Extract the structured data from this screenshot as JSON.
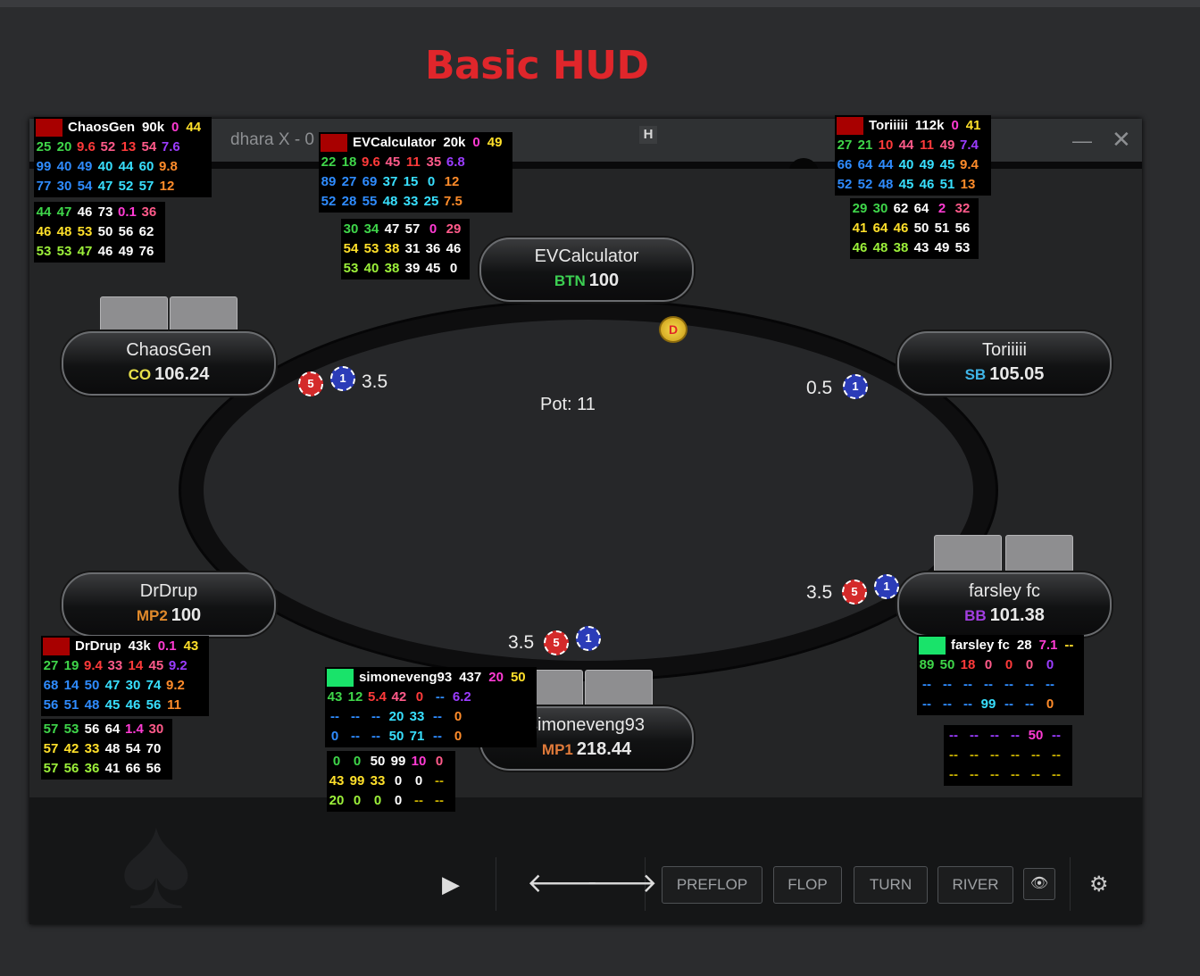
{
  "page_title": "Basic HUD",
  "window": {
    "title": "dhara X - 0",
    "minimize_glyph": "—",
    "close_glyph": "✕",
    "logo_glyph": "H"
  },
  "icons": {
    "dealer_button": "D",
    "chip_red": "5",
    "chip_blue": "1",
    "play": "▶",
    "back": "🡐",
    "forward": "🡒",
    "eye": "👁",
    "gear": "⚙",
    "spade": "♠"
  },
  "pot": "Pot:  11",
  "bets": {
    "chaosgen": "3.5",
    "toriiiii": "0.5",
    "drdrup": "3.5",
    "farsley": "3.5"
  },
  "controls": {
    "street_buttons": [
      "PREFLOP",
      "FLOP",
      "TURN",
      "RIVER"
    ]
  },
  "seats": {
    "evcalc": {
      "name": "EVCalculator",
      "pos": "BTN",
      "stack": "100",
      "pos_color": "#3ccf52"
    },
    "chaosgen": {
      "name": "ChaosGen",
      "pos": "CO",
      "stack": "106.24",
      "pos_color": "#e8e04a"
    },
    "toriiiii": {
      "name": "Toriiiii",
      "pos": "SB",
      "stack": "105.05",
      "pos_color": "#3fb5e8"
    },
    "drdrup": {
      "name": "DrDrup",
      "pos": "MP2",
      "stack": "100",
      "pos_color": "#e08a2b"
    },
    "farsley": {
      "name": "farsley fc",
      "pos": "BB",
      "stack": "101.38",
      "pos_color": "#a23ee0"
    },
    "simone": {
      "name": "simoneveng93",
      "pos": "MP1",
      "stack": "218.44",
      "pos_color": "#e07a3a"
    }
  },
  "huds": {
    "chaosgen": {
      "flag_color": "#a80000",
      "header": [
        "ChaosGen",
        "90k",
        "0",
        "44"
      ],
      "block1": [
        [
          "25",
          "20",
          "9.6",
          "52",
          "13",
          "54",
          "7.6"
        ],
        [
          "99",
          "40",
          "49",
          "40",
          "44",
          "60",
          "9.8"
        ],
        [
          "77",
          "30",
          "54",
          "47",
          "52",
          "57",
          "12"
        ]
      ],
      "block2": [
        [
          "44",
          "47",
          "46",
          "73",
          "0.1",
          "36"
        ],
        [
          "46",
          "48",
          "53",
          "50",
          "56",
          "62"
        ],
        [
          "53",
          "53",
          "47",
          "46",
          "49",
          "76"
        ]
      ]
    },
    "evcalc": {
      "flag_color": "#a80000",
      "header": [
        "EVCalculator",
        "20k",
        "0",
        "49"
      ],
      "block1": [
        [
          "22",
          "18",
          "9.6",
          "45",
          "11",
          "35",
          "6.8"
        ],
        [
          "89",
          "27",
          "69",
          "37",
          "15",
          "0",
          "12"
        ],
        [
          "52",
          "28",
          "55",
          "48",
          "33",
          "25",
          "7.5"
        ]
      ],
      "block2": [
        [
          "30",
          "34",
          "47",
          "57",
          "0",
          "29"
        ],
        [
          "54",
          "53",
          "38",
          "31",
          "36",
          "46"
        ],
        [
          "53",
          "40",
          "38",
          "39",
          "45",
          "0"
        ]
      ]
    },
    "toriiiii": {
      "flag_color": "#a80000",
      "header": [
        "Toriiiii",
        "112k",
        "0",
        "41"
      ],
      "block1": [
        [
          "27",
          "21",
          "10",
          "44",
          "11",
          "49",
          "7.4"
        ],
        [
          "66",
          "64",
          "44",
          "40",
          "49",
          "45",
          "9.4"
        ],
        [
          "52",
          "52",
          "48",
          "45",
          "46",
          "51",
          "13"
        ]
      ],
      "block2": [
        [
          "29",
          "30",
          "62",
          "64",
          "2",
          "32"
        ],
        [
          "41",
          "64",
          "46",
          "50",
          "51",
          "56"
        ],
        [
          "46",
          "48",
          "38",
          "43",
          "49",
          "53"
        ]
      ]
    },
    "drdrup": {
      "flag_color": "#a80000",
      "header": [
        "DrDrup",
        "43k",
        "0.1",
        "43"
      ],
      "block1": [
        [
          "27",
          "19",
          "9.4",
          "33",
          "14",
          "45",
          "9.2"
        ],
        [
          "68",
          "14",
          "50",
          "47",
          "30",
          "74",
          "9.2"
        ],
        [
          "56",
          "51",
          "48",
          "45",
          "46",
          "56",
          "11"
        ]
      ],
      "block2": [
        [
          "57",
          "53",
          "56",
          "64",
          "1.4",
          "30"
        ],
        [
          "57",
          "42",
          "33",
          "48",
          "54",
          "70"
        ],
        [
          "57",
          "56",
          "36",
          "41",
          "66",
          "56"
        ]
      ]
    },
    "simone": {
      "flag_color": "#19e36a",
      "header": [
        "simoneveng93",
        "437",
        "20",
        "50"
      ],
      "block1": [
        [
          "43",
          "12",
          "5.4",
          "42",
          "0",
          "--",
          "6.2"
        ],
        [
          "--",
          "--",
          "--",
          "20",
          "33",
          "--",
          "0"
        ],
        [
          "0",
          "--",
          "--",
          "50",
          "71",
          "--",
          "0"
        ]
      ],
      "block2": [
        [
          "0",
          "0",
          "50",
          "99",
          "10",
          "0"
        ],
        [
          "43",
          "99",
          "33",
          "0",
          "0",
          "--"
        ],
        [
          "20",
          "0",
          "0",
          "0",
          "--",
          "--"
        ]
      ]
    },
    "farsley": {
      "flag_color": "#19e36a",
      "header": [
        "farsley fc",
        "28",
        "7.1",
        "--"
      ],
      "block1": [
        [
          "89",
          "50",
          "18",
          "0",
          "0",
          "0",
          "0"
        ],
        [
          "--",
          "--",
          "--",
          "--",
          "--",
          "--",
          "--"
        ],
        [
          "--",
          "--",
          "--",
          "99",
          "--",
          "--",
          "0"
        ]
      ],
      "block2": [
        [
          "--",
          "--",
          "--",
          "--",
          "50",
          "--"
        ],
        [
          "--",
          "--",
          "--",
          "--",
          "--",
          "--"
        ],
        [
          "--",
          "--",
          "--",
          "--",
          "--",
          "--"
        ]
      ]
    }
  },
  "hud_colors": {
    "header": [
      "#ffffff",
      "#ff3bd4",
      "#ffe02a"
    ],
    "block1": [
      [
        "#3fd64a",
        "#3fd64a",
        "#ff3a3a",
        "#ff5a8a",
        "#ff3a3a",
        "#ff5a8a",
        "#9b3cff"
      ],
      [
        "#2f8cff",
        "#2f8cff",
        "#2f8cff",
        "#38e0ff",
        "#38e0ff",
        "#38e0ff",
        "#ff8c2a"
      ],
      [
        "#2f8cff",
        "#2f8cff",
        "#2f8cff",
        "#38e0ff",
        "#38e0ff",
        "#38e0ff",
        "#ff8c2a"
      ]
    ],
    "block2": [
      [
        "#3fd64a",
        "#3fd64a",
        "#ffffff",
        "#ffffff",
        "#ff3bd4",
        "#ff5a8a"
      ],
      [
        "#ffe02a",
        "#ffe02a",
        "#ffe02a",
        "#ffffff",
        "#ffffff",
        "#ffffff"
      ],
      [
        "#9cf03a",
        "#9cf03a",
        "#9cf03a",
        "#ffffff",
        "#ffffff",
        "#ffffff"
      ]
    ]
  }
}
